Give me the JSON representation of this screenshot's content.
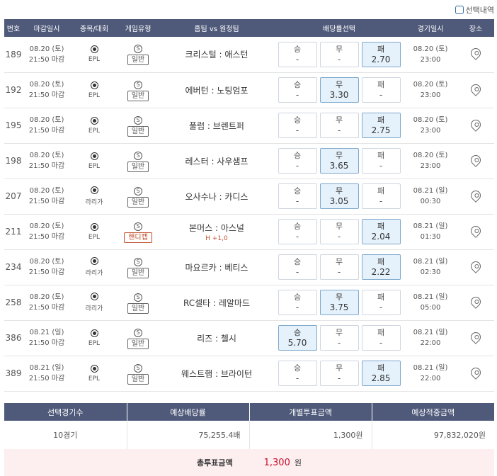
{
  "topbar": {
    "label": "선택내역"
  },
  "headers": [
    "번호",
    "마감일시",
    "종목/대회",
    "게임유형",
    "홈팀 vs 원정팀",
    "배당률선택",
    "경기일시",
    "장소"
  ],
  "game_icon": "S",
  "rows": [
    {
      "no": "189",
      "deadline_date": "08.20 (토)",
      "deadline_time": "21:50 마감",
      "league": "EPL",
      "type": "일반",
      "match": "크리스털 : 애스턴",
      "handicap": "",
      "win_label": "승",
      "win_val": "-",
      "draw_label": "무",
      "draw_val": "-",
      "lose_label": "패",
      "lose_val": "2.70",
      "selected": "lose",
      "game_date": "08.20 (토)",
      "game_time": "23:00"
    },
    {
      "no": "192",
      "deadline_date": "08.20 (토)",
      "deadline_time": "21:50 마감",
      "league": "EPL",
      "type": "일반",
      "match": "에버턴 : 노팅엄포",
      "handicap": "",
      "win_label": "승",
      "win_val": "-",
      "draw_label": "무",
      "draw_val": "3.30",
      "lose_label": "패",
      "lose_val": "-",
      "selected": "draw",
      "game_date": "08.20 (토)",
      "game_time": "23:00"
    },
    {
      "no": "195",
      "deadline_date": "08.20 (토)",
      "deadline_time": "21:50 마감",
      "league": "EPL",
      "type": "일반",
      "match": "풀럼 : 브렌트퍼",
      "handicap": "",
      "win_label": "승",
      "win_val": "-",
      "draw_label": "무",
      "draw_val": "-",
      "lose_label": "패",
      "lose_val": "2.75",
      "selected": "lose",
      "game_date": "08.20 (토)",
      "game_time": "23:00"
    },
    {
      "no": "198",
      "deadline_date": "08.20 (토)",
      "deadline_time": "21:50 마감",
      "league": "EPL",
      "type": "일반",
      "match": "레스터 : 사우샘프",
      "handicap": "",
      "win_label": "승",
      "win_val": "-",
      "draw_label": "무",
      "draw_val": "3.65",
      "lose_label": "패",
      "lose_val": "-",
      "selected": "draw",
      "game_date": "08.20 (토)",
      "game_time": "23:00"
    },
    {
      "no": "207",
      "deadline_date": "08.20 (토)",
      "deadline_time": "21:50 마감",
      "league": "라리가",
      "type": "일반",
      "match": "오사수나 : 카디스",
      "handicap": "",
      "win_label": "승",
      "win_val": "-",
      "draw_label": "무",
      "draw_val": "3.05",
      "lose_label": "패",
      "lose_val": "-",
      "selected": "draw",
      "game_date": "08.21 (일)",
      "game_time": "00:30"
    },
    {
      "no": "211",
      "deadline_date": "08.20 (토)",
      "deadline_time": "21:50 마감",
      "league": "EPL",
      "type": "핸디캡",
      "match": "본머스 : 아스널",
      "handicap": "H +1,0",
      "win_label": "승",
      "win_val": "-",
      "draw_label": "무",
      "draw_val": "-",
      "lose_label": "패",
      "lose_val": "2.04",
      "selected": "lose",
      "game_date": "08.21 (일)",
      "game_time": "01:30"
    },
    {
      "no": "234",
      "deadline_date": "08.20 (토)",
      "deadline_time": "21:50 마감",
      "league": "라리가",
      "type": "일반",
      "match": "마요르카 : 베티스",
      "handicap": "",
      "win_label": "승",
      "win_val": "-",
      "draw_label": "무",
      "draw_val": "-",
      "lose_label": "패",
      "lose_val": "2.22",
      "selected": "lose",
      "game_date": "08.21 (일)",
      "game_time": "02:30"
    },
    {
      "no": "258",
      "deadline_date": "08.20 (토)",
      "deadline_time": "21:50 마감",
      "league": "라리가",
      "type": "일반",
      "match": "RC셀타 : 레알마드",
      "handicap": "",
      "win_label": "승",
      "win_val": "-",
      "draw_label": "무",
      "draw_val": "3.75",
      "lose_label": "패",
      "lose_val": "-",
      "selected": "draw",
      "game_date": "08.21 (일)",
      "game_time": "05:00"
    },
    {
      "no": "386",
      "deadline_date": "08.21 (일)",
      "deadline_time": "21:50 마감",
      "league": "EPL",
      "type": "일반",
      "match": "리즈 : 첼시",
      "handicap": "",
      "win_label": "승",
      "win_val": "5.70",
      "draw_label": "무",
      "draw_val": "-",
      "lose_label": "패",
      "lose_val": "-",
      "selected": "win",
      "game_date": "08.21 (일)",
      "game_time": "22:00"
    },
    {
      "no": "389",
      "deadline_date": "08.21 (일)",
      "deadline_time": "21:50 마감",
      "league": "EPL",
      "type": "일반",
      "match": "웨스트햄 : 브라이턴",
      "handicap": "",
      "win_label": "승",
      "win_val": "-",
      "draw_label": "무",
      "draw_val": "-",
      "lose_label": "패",
      "lose_val": "2.85",
      "selected": "lose",
      "game_date": "08.21 (일)",
      "game_time": "22:00"
    }
  ],
  "summary": {
    "headers": [
      "선택경기수",
      "예상배당률",
      "개별투표금액",
      "예상적중금액"
    ],
    "values": [
      "10경기",
      "75,255.4배",
      "1,300원",
      "97,832,020원"
    ]
  },
  "total": {
    "label": "총투표금액",
    "amount": "1,300",
    "unit": "원"
  },
  "colors": {
    "header_bg": "#4f5a7a",
    "selected_bg": "#e5f1fb",
    "handicap": "#c0502b",
    "total_amount": "#c8102e",
    "total_bg": "#fdeef0"
  },
  "icons": {
    "league": "soccer-ball-icon",
    "game": "s-circle-icon",
    "venue": "map-pin-icon"
  }
}
